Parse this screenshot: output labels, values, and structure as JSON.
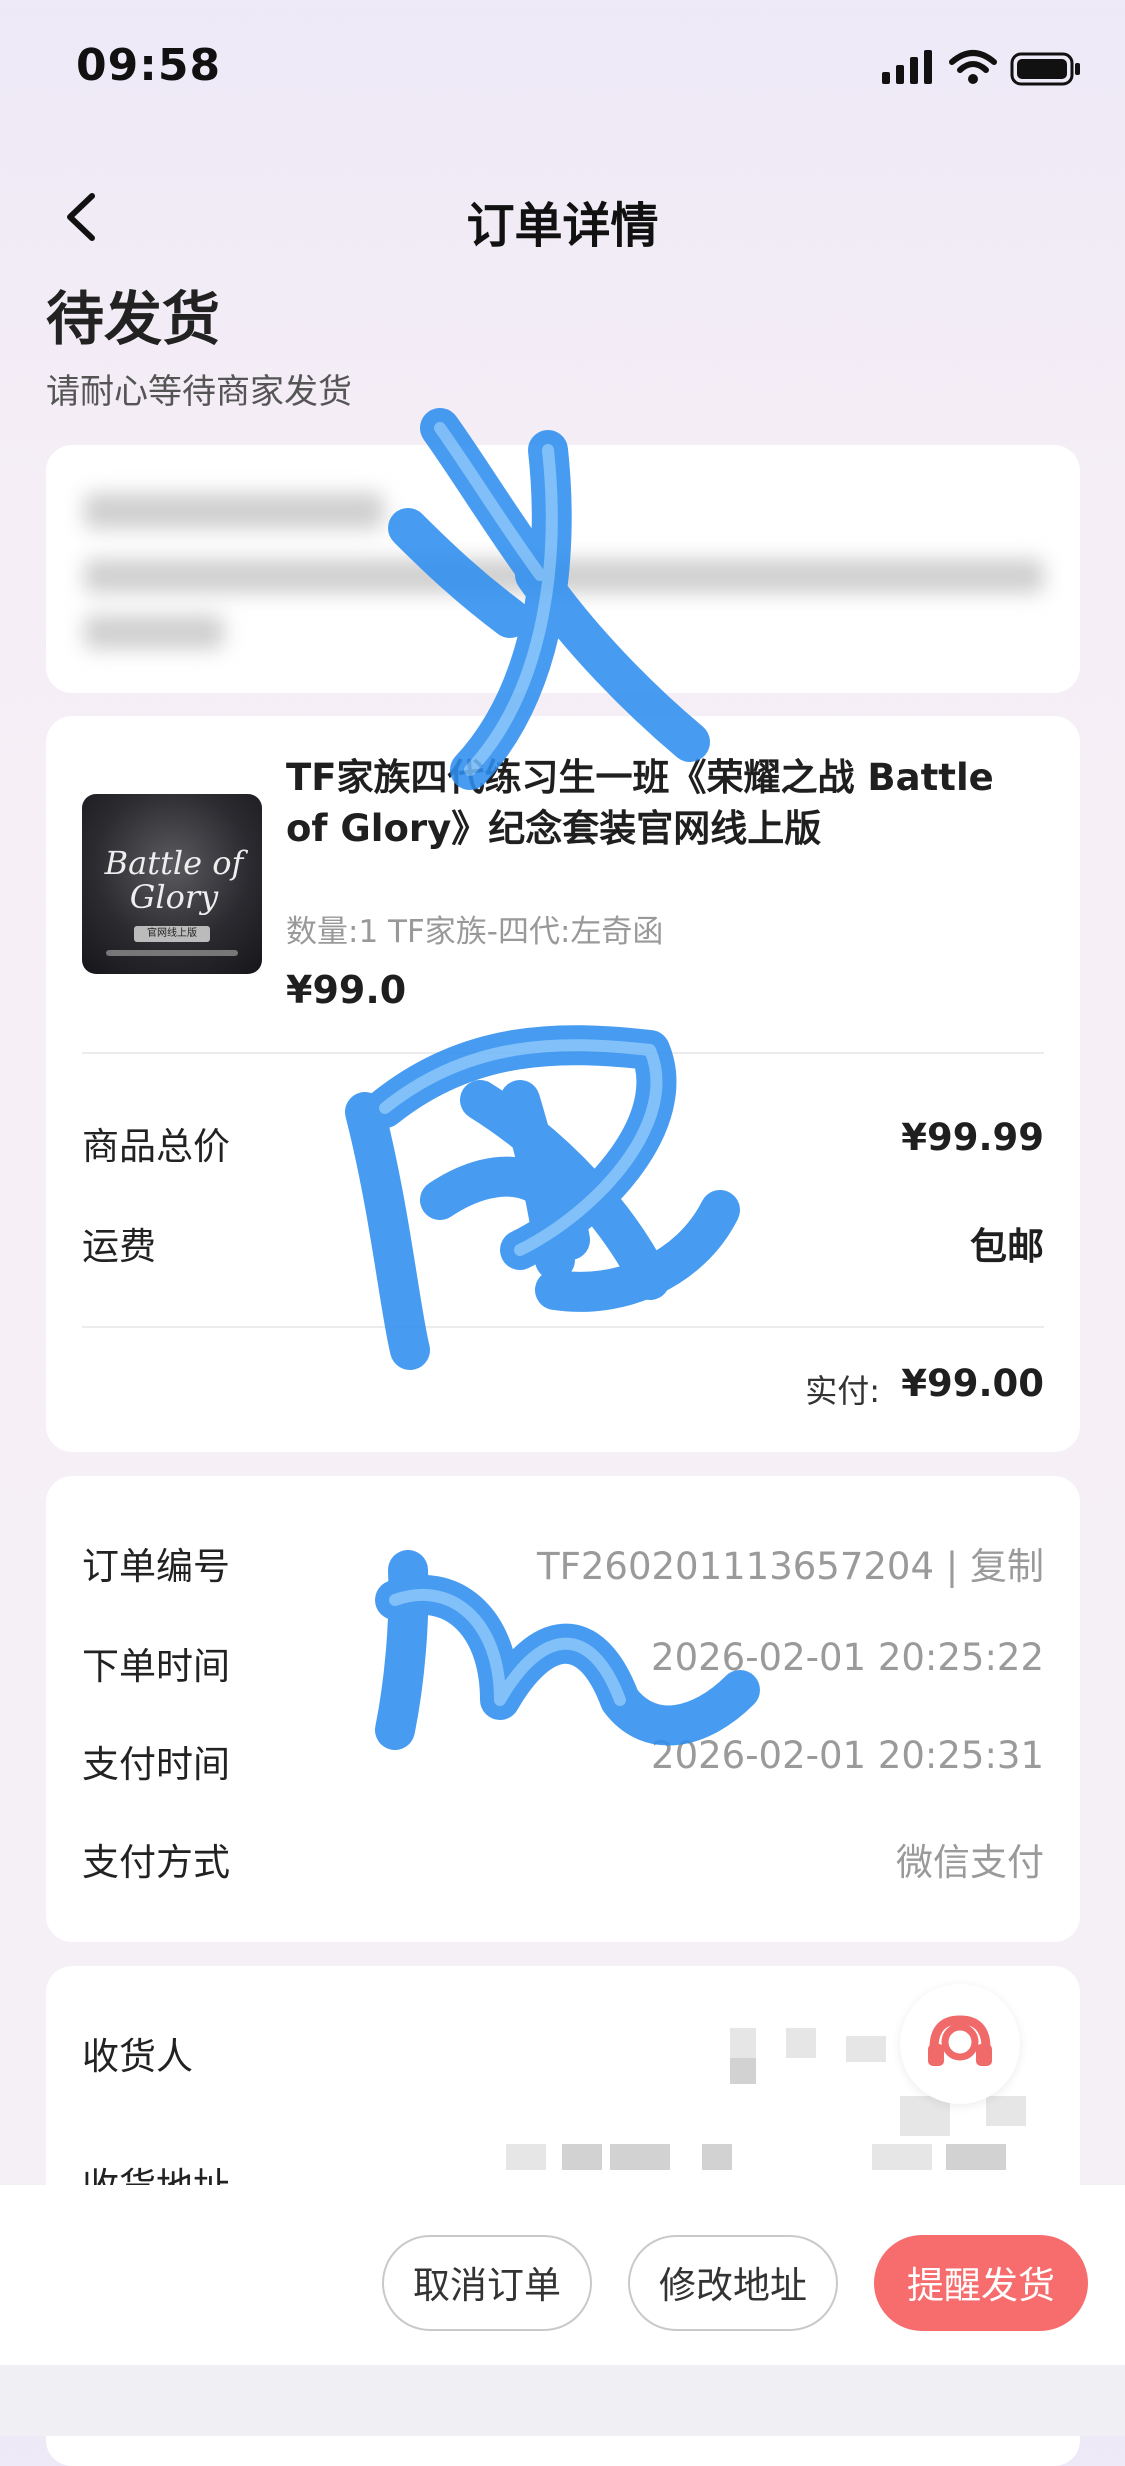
{
  "status_bar": {
    "time": "09:58"
  },
  "nav": {
    "title": "订单详情"
  },
  "order_status": {
    "title": "待发货",
    "subtitle": "请耐心等待商家发货"
  },
  "product": {
    "name": "TF家族四代练习生一班《荣耀之战 Battle of Glory》纪念套装官网线上版",
    "spec": "数量:1 TF家族-四代:左奇函",
    "price": "¥99.0",
    "thumbnail_text": "Battle of Glory",
    "thumbnail_badge": "官网线上版"
  },
  "summary": {
    "goods_total_label": "商品总价",
    "goods_total_value": "¥99.99",
    "shipping_label": "运费",
    "shipping_value": "包邮",
    "paid_label": "实付:",
    "paid_value": "¥99.00"
  },
  "order_info": {
    "order_no_label": "订单编号",
    "order_no_value": "TF260201113657204",
    "copy_label": "| 复制",
    "order_time_label": "下单时间",
    "order_time_value": "2026-02-01 20:25:22",
    "pay_time_label": "支付时间",
    "pay_time_value": "2026-02-01 20:25:31",
    "pay_method_label": "支付方式",
    "pay_method_value": "微信支付"
  },
  "receiver": {
    "name_label": "收货人",
    "address_label": "收货地址"
  },
  "actions": {
    "cancel": "取消订单",
    "modify_address": "修改地址",
    "remind": "提醒发货"
  },
  "colors": {
    "primary_button": "#f76d6d",
    "scribble": "#2e8ff0",
    "service_icon": "#f06a6a"
  },
  "icons": [
    "back-icon",
    "signal-icon",
    "wifi-icon",
    "battery-icon",
    "customer-service-icon"
  ]
}
